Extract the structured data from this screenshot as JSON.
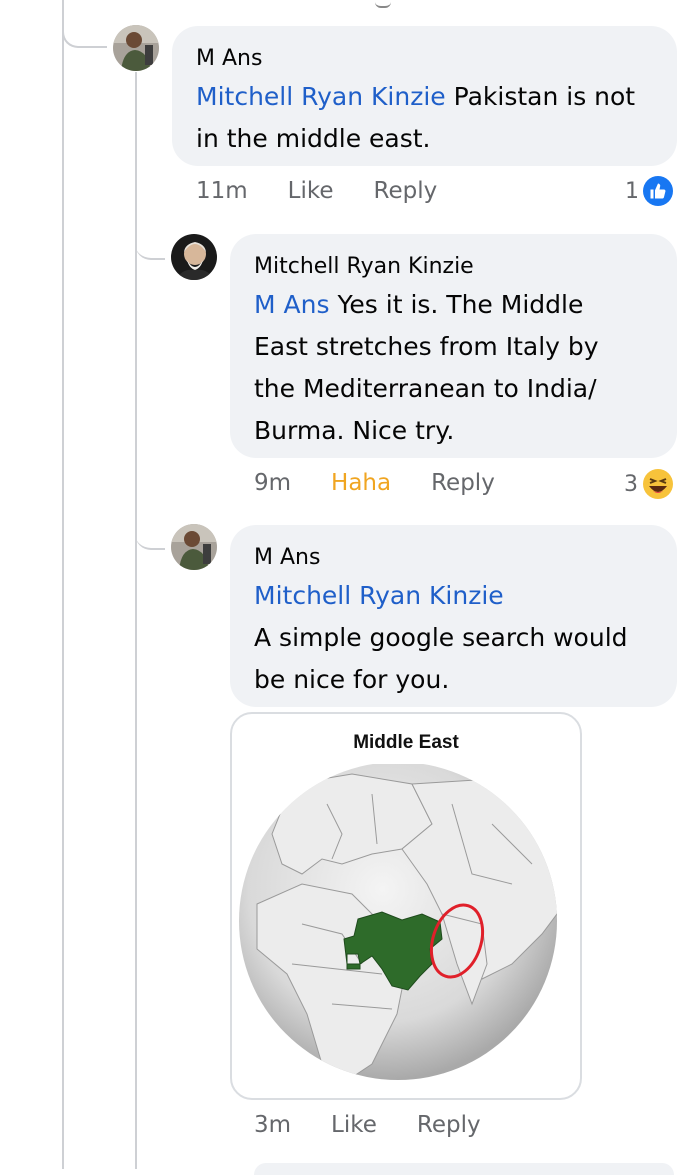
{
  "comments": [
    {
      "author": "M Ans",
      "mention": "Mitchell Ryan Kinzie",
      "text_line1": " Pakistan is not",
      "text_line2": "in the middle east.",
      "time": "11m",
      "action_like": "Like",
      "action_reply": "Reply",
      "reaction_count": "1",
      "reaction_type": "like"
    },
    {
      "author": "Mitchell Ryan Kinzie",
      "mention": "M Ans",
      "text_line1": " Yes it is. The Middle",
      "text_line2": "East stretches from Italy by",
      "text_line3": "the Mediterranean to India/",
      "text_line4": "Burma. Nice try.",
      "time": "9m",
      "action_like": "Haha",
      "action_reply": "Reply",
      "reaction_count": "3",
      "reaction_type": "haha"
    },
    {
      "author": "M Ans",
      "mention": "Mitchell Ryan Kinzie",
      "text_line1": "A simple google search would",
      "text_line2": "be nice for you.",
      "time": "3m",
      "action_like": "Like",
      "action_reply": "Reply",
      "attachment_title": "Middle East"
    }
  ],
  "colors": {
    "mention": "#1f5fc9",
    "bubble": "#f0f2f5",
    "haha": "#f0a521",
    "like_badge": "#1877f2",
    "map_highlight": "#2e6b2a",
    "map_circle": "#e0202a"
  }
}
